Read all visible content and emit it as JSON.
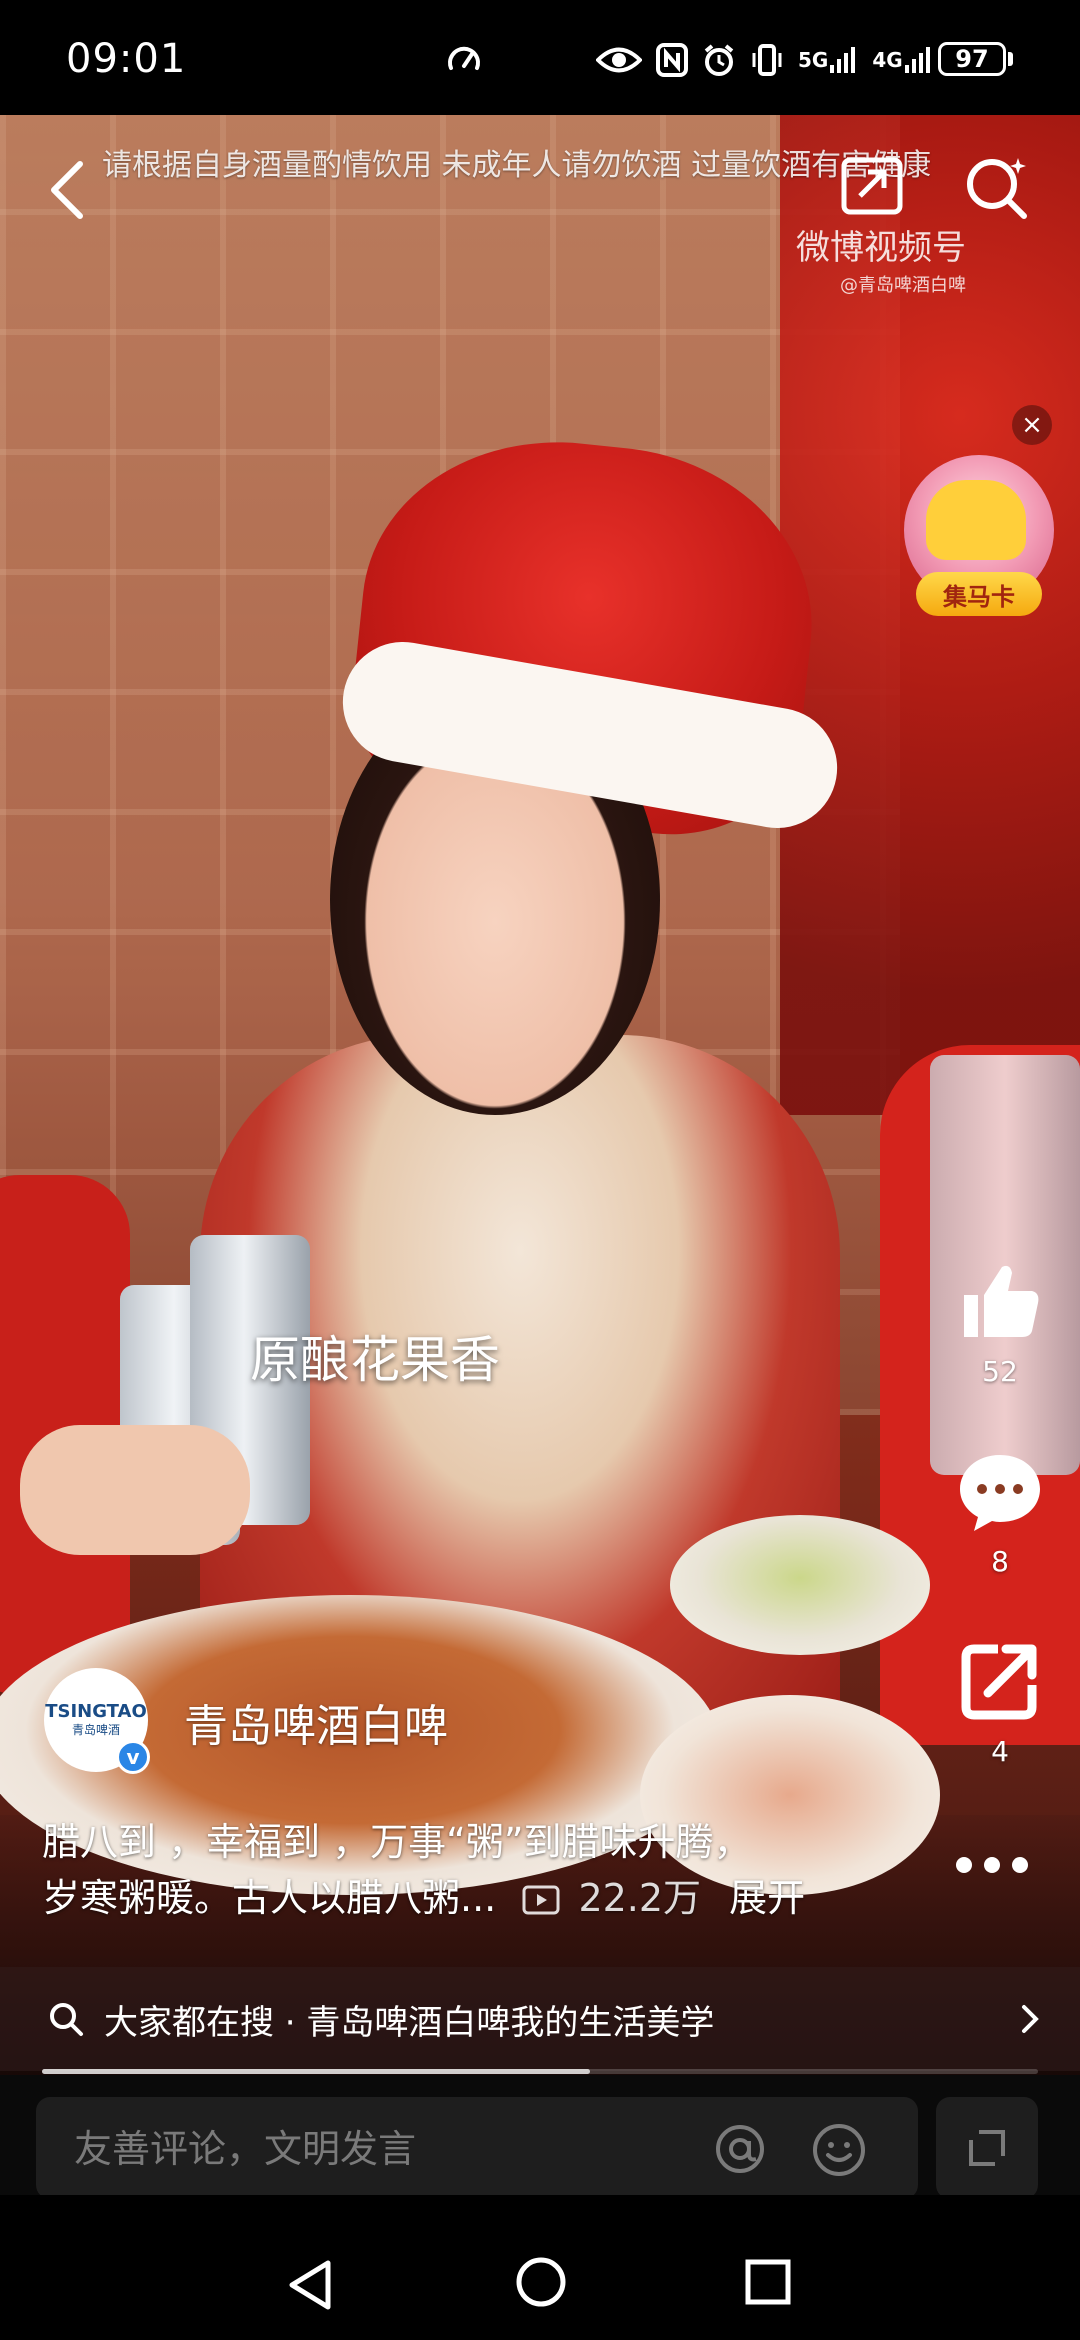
{
  "status_bar": {
    "time": "09:01",
    "network_5g": "5G",
    "network_4g": "4G",
    "battery": "97"
  },
  "video": {
    "warning": "请根据自身酒量酌情饮用 未成年人请勿饮酒 过量饮酒有害健康",
    "watermark_brand": "微博视频号",
    "watermark_handle": "@青岛啤酒白啤",
    "subtitle_overlay": "原酿花果香",
    "promo_card_label": "集马卡"
  },
  "actions": {
    "like_count": "52",
    "comment_count": "8",
    "share_count": "4"
  },
  "author": {
    "avatar_brand": "TSINGTAO",
    "avatar_sub": "青岛啤酒",
    "name": "青岛啤酒白啤"
  },
  "description": {
    "line1": "腊八到 ，幸福到 ，万事“粥”到腊味升腾，",
    "line2": "岁寒粥暖。古人以腊八粥...",
    "play_count": "22.2万",
    "expand_label": "展开"
  },
  "hot_search": {
    "text": "大家都在搜 · 青岛啤酒白啤我的生活美学"
  },
  "playback": {
    "progress_fraction": 0.55
  },
  "comment": {
    "placeholder": "友善评论，文明发言"
  },
  "colors": {
    "accent_verified": "#2a86e6",
    "card_label": "#ffc52a"
  }
}
